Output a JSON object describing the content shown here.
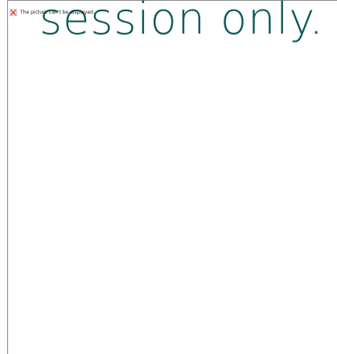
{
  "placeholder": {
    "icon": "broken-image-icon",
    "message": "The picture can't be displayed."
  },
  "slide": {
    "text": "session only.",
    "text_color": "#0f5a5a"
  }
}
